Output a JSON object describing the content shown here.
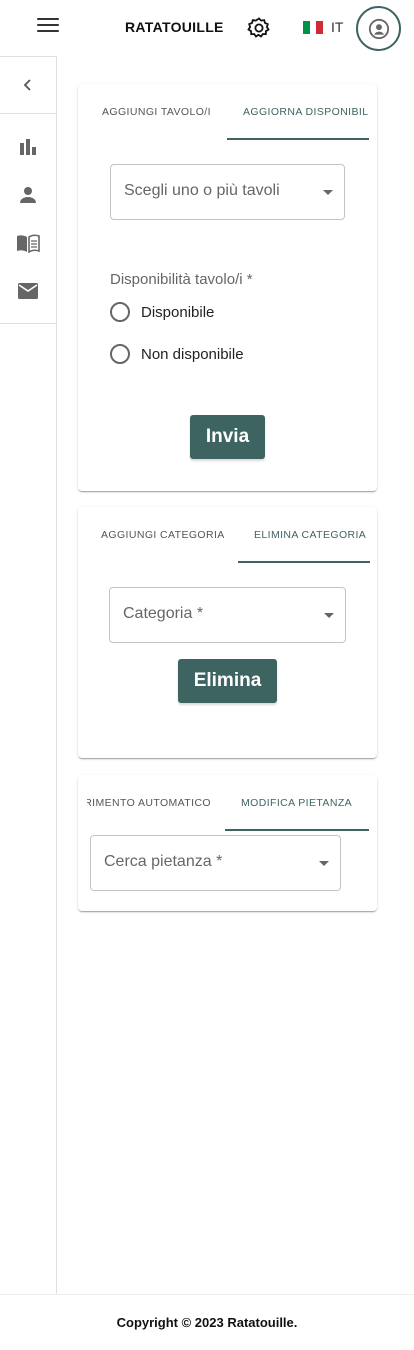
{
  "header": {
    "brand": "RATATOUILLE",
    "language": "IT",
    "flag_colors": [
      "#009246",
      "#ffffff",
      "#ce2b37"
    ],
    "menu_icon": "hamburger-icon",
    "settings_icon": "gear-icon",
    "account_icon": "account-circle-icon"
  },
  "sidebar": {
    "items": [
      {
        "icon": "chevron-left-icon"
      },
      {
        "icon": "bar-chart-icon"
      },
      {
        "icon": "person-icon"
      },
      {
        "icon": "menu-book-icon"
      },
      {
        "icon": "mail-icon"
      }
    ]
  },
  "card_tables": {
    "tabs": [
      "AGGIUNGI TAVOLO/I",
      "AGGIORNA DISPONIBILITÀ"
    ],
    "active_tab": 1,
    "select_placeholder": "Scegli uno o più tavoli",
    "availability_label": "Disponibilità tavolo/i *",
    "options": [
      "Disponibile",
      "Non disponibile"
    ],
    "submit_label": "Invia"
  },
  "card_categories": {
    "tabs": [
      "AGGIUNGI CATEGORIA",
      "ELIMINA CATEGORIA"
    ],
    "active_tab": 1,
    "select_placeholder": "Categoria *",
    "delete_label": "Elimina"
  },
  "card_dishes": {
    "tabs": [
      "INSERIMENTO AUTOMATICO",
      "MODIFICA PIETANZA"
    ],
    "active_tab": 1,
    "select_placeholder": "Cerca pietanza *"
  },
  "footer": {
    "copyright": "Copyright © 2023 Ratatouille."
  },
  "colors": {
    "accent": "#3e6462"
  }
}
